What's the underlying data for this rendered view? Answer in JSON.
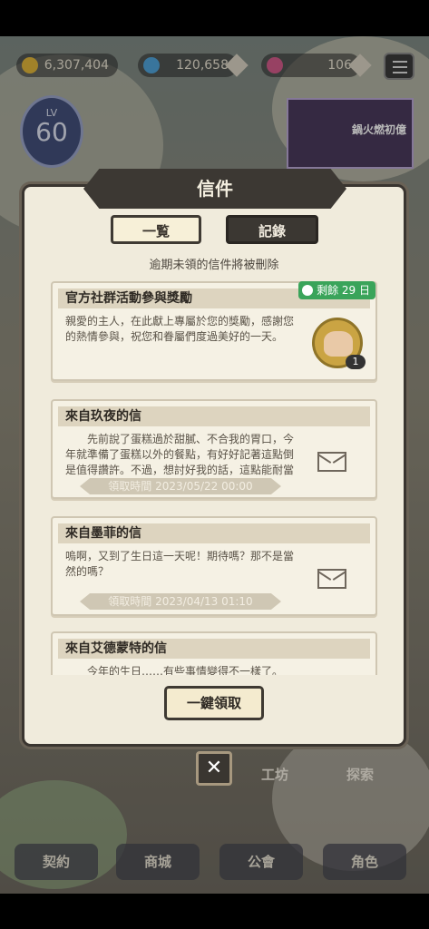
{
  "resources": {
    "gold": "6,307,404",
    "gems": "120,658",
    "hearts": "106"
  },
  "level": {
    "label": "LV",
    "value": "60"
  },
  "banner_text": "鍋火燃初億",
  "side_labels": {
    "workshop": "工坊",
    "explore": "探索"
  },
  "bottom_nav": [
    "契約",
    "商城",
    "公會",
    "角色"
  ],
  "dialog": {
    "title": "信件",
    "tabs": {
      "list": "一覧",
      "record": "記錄"
    },
    "notice": "逾期未領的信件將被刪除",
    "claim_all": "一鍵領取",
    "close": "✕"
  },
  "mails": [
    {
      "title": "官方社群活動參與獎勵",
      "body": "親愛的主人，在此獻上專屬於您的獎勵，感謝您的熱情參與，祝您和眷屬們度過美好的一天。",
      "expire": "剩餘 29 日",
      "reward_count": "1"
    },
    {
      "title": "來自玖夜的信",
      "body": "　　先前說了蛋糕過於甜膩、不合我的胃口，今年就準備了蛋糕以外的餐點，有好好記著這點倒是值得讚許。不過，想討好我的話，這點能耐當",
      "time": "領取時間 2023/05/22 00:00"
    },
    {
      "title": "來自墨菲的信",
      "body": "嗚啊，又到了生日這一天呢！期待嗎？那不是當然的嗎？",
      "time": "領取時間 2023/04/13 01:10"
    },
    {
      "title": "來自艾德蒙特的信",
      "body": "　　今年的生日……有些事情變得不一樣了。"
    }
  ],
  "colors": {
    "accent_green": "#3aa45a",
    "dialog_bg": "#f0ebdc",
    "dark": "#3c3833"
  }
}
